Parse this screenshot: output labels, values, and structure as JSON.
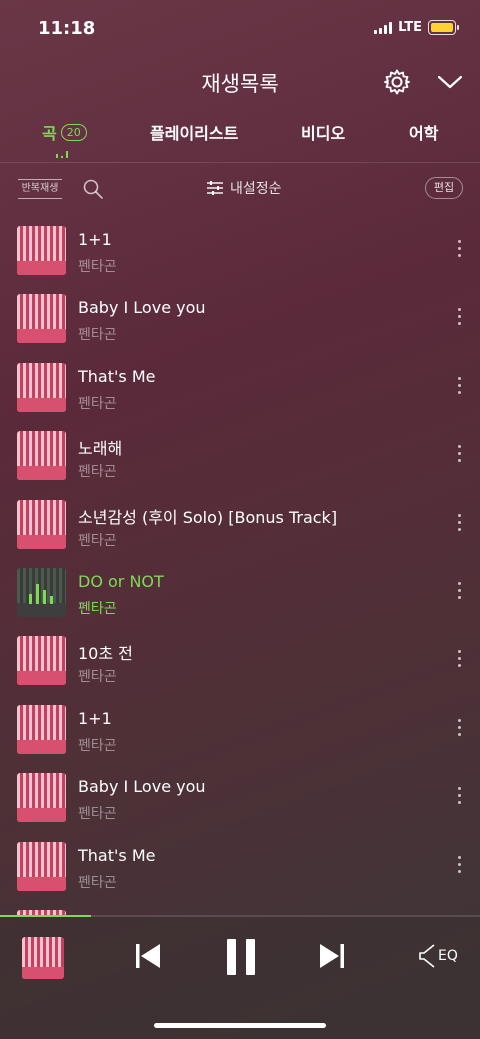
{
  "status": {
    "time": "11:18",
    "network": "LTE",
    "battery_color": "#ffd233"
  },
  "header": {
    "title": "재생목록"
  },
  "tabs": {
    "songs": {
      "label": "곡",
      "count": "20"
    },
    "playlist": {
      "label": "플레이리스트"
    },
    "video": {
      "label": "비디오"
    },
    "language": {
      "label": "어학"
    }
  },
  "toolbar": {
    "repeat_label": "반복재생",
    "sort_label": "내설정순",
    "edit_label": "편집"
  },
  "songs": [
    {
      "title": "1+1",
      "artist": "펜타곤"
    },
    {
      "title": "Baby I Love you",
      "artist": "펜타곤"
    },
    {
      "title": "That's Me",
      "artist": "펜타곤"
    },
    {
      "title": "노래해",
      "artist": "펜타곤"
    },
    {
      "title": "소년감성 (후이 Solo) [Bonus Track]",
      "artist": "펜타곤"
    },
    {
      "title": "DO or NOT",
      "artist": "펜타곤"
    },
    {
      "title": "10초 전",
      "artist": "펜타곤"
    },
    {
      "title": "1+1",
      "artist": "펜타곤"
    },
    {
      "title": "Baby I Love you",
      "artist": "펜타곤"
    },
    {
      "title": "That's Me",
      "artist": "펜타곤"
    }
  ],
  "player": {
    "eq_label": "EQ",
    "progress_fraction": 0.19
  },
  "colors": {
    "accent": "#7ed957"
  },
  "icons": [
    "gear-icon",
    "chevron-down-icon",
    "search-icon",
    "sort-icon",
    "more-icon",
    "prev-icon",
    "pause-icon",
    "next-icon",
    "eq-speaker-icon"
  ]
}
